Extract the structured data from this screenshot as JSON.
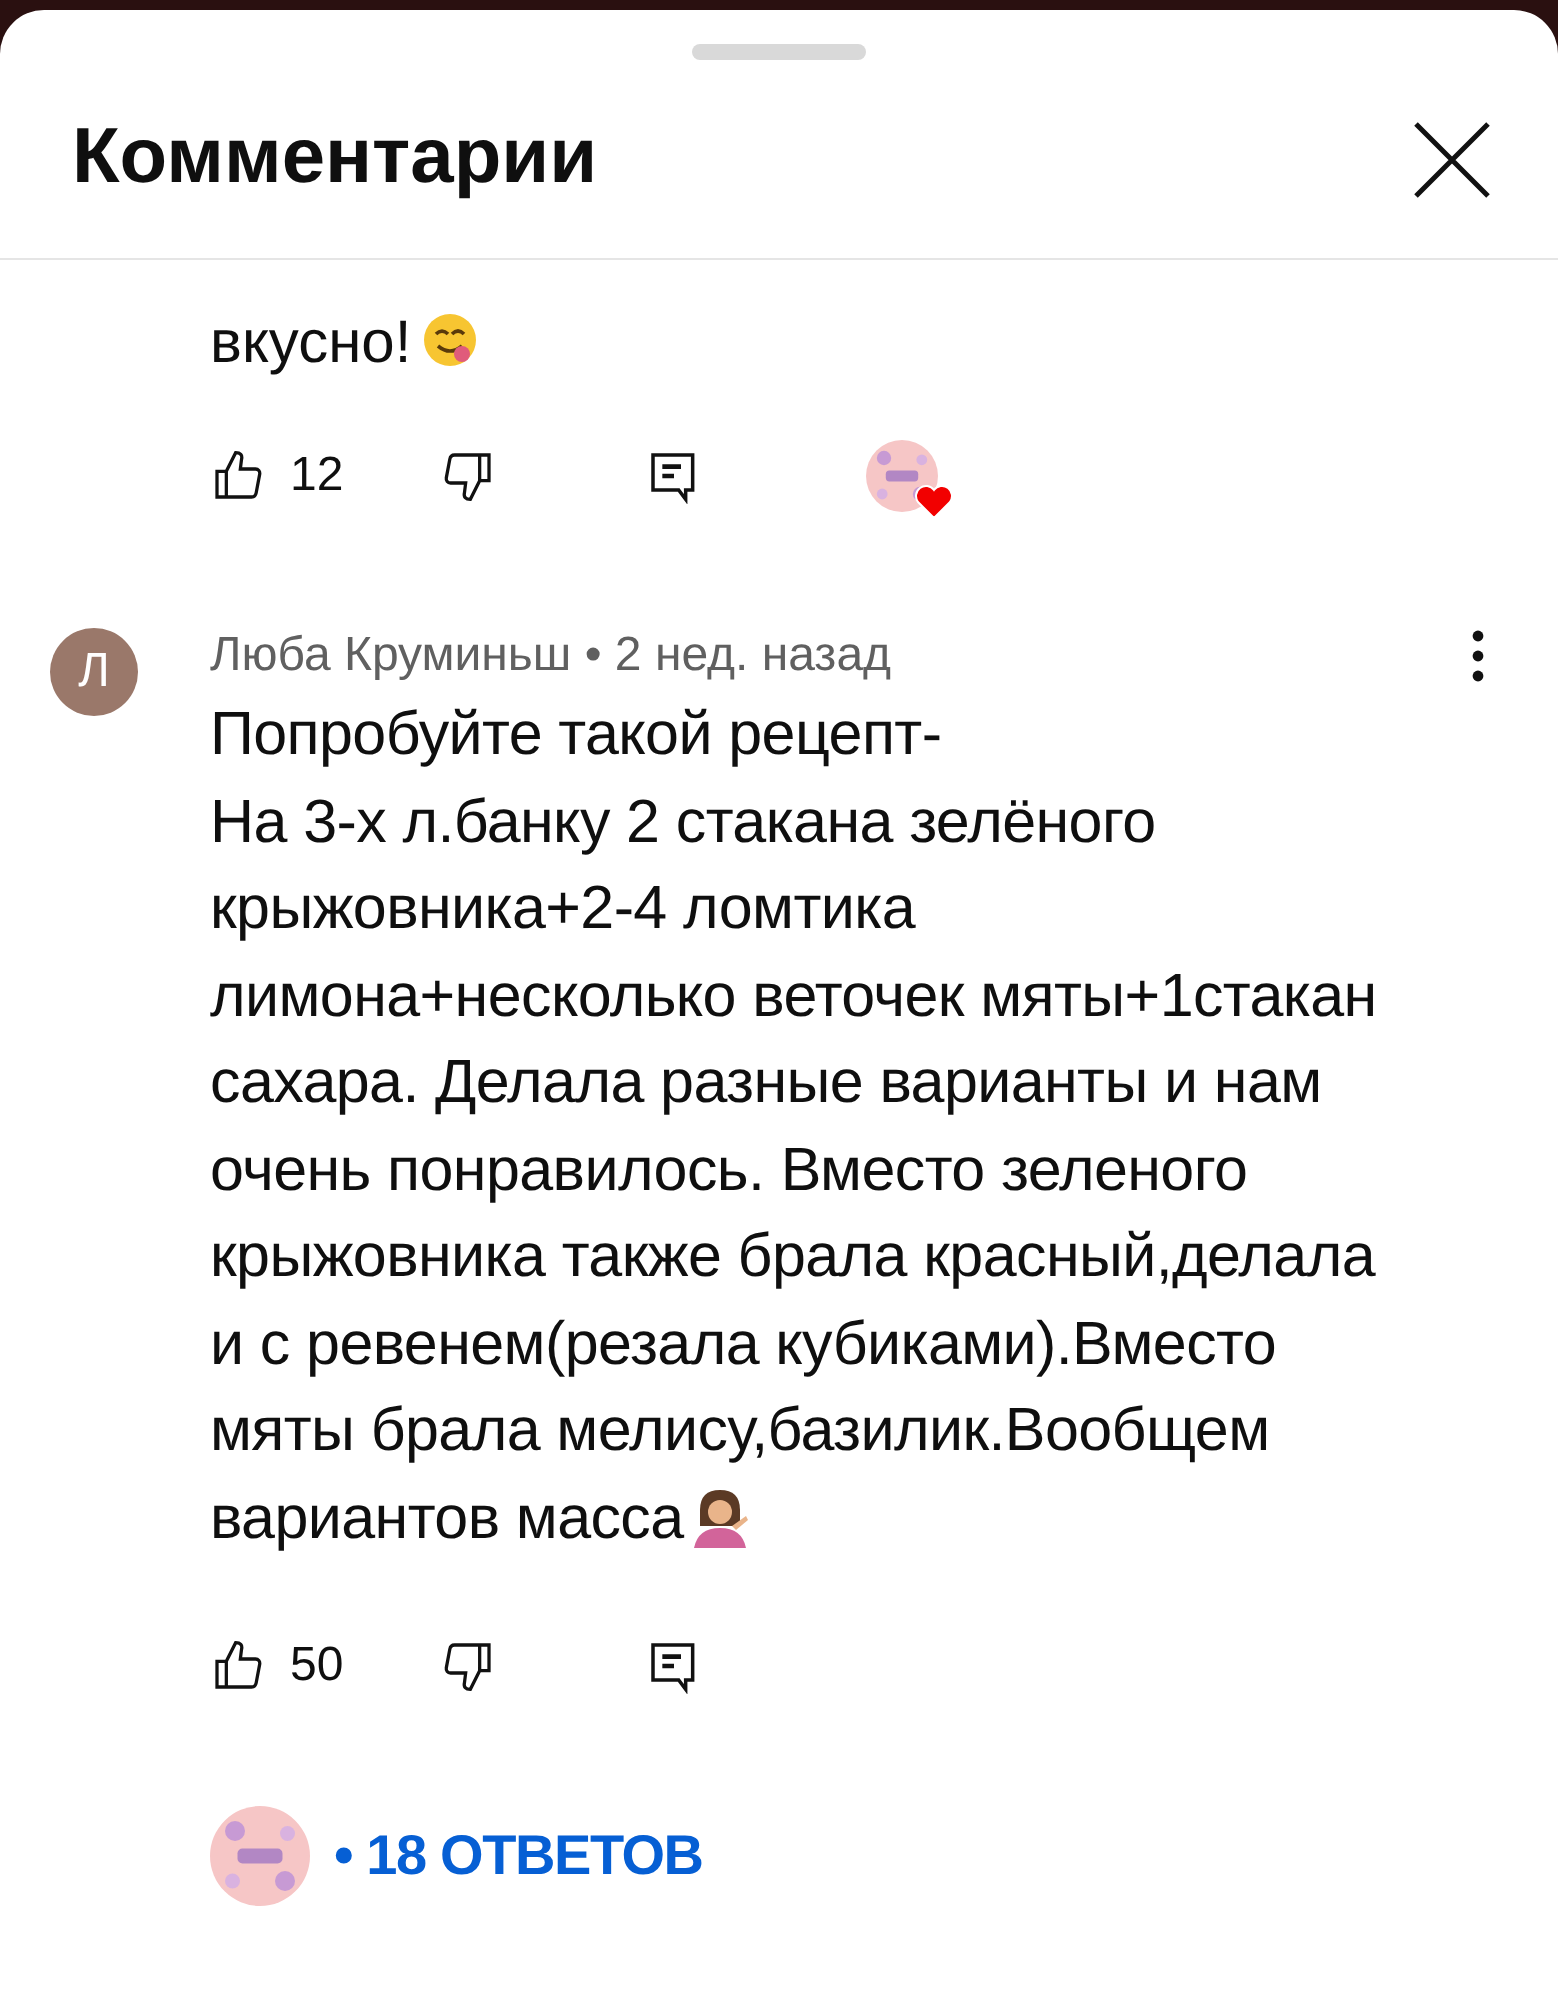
{
  "header": {
    "title": "Комментарии"
  },
  "comments": [
    {
      "lines": [
        "вкусно!"
      ],
      "kind": "face-emoji",
      "likes": "12",
      "creator_heart": true
    },
    {
      "avatar_letter": "Л",
      "author": "Люба Круминьш",
      "separator": "•",
      "time": "2 нед. назад",
      "lines": [
        "Попробуйте такой рецепт-",
        "На 3-х л.банку 2 стакана зелёного",
        "крыжовника+2-4 ломтика",
        "лимона+несколько веточек мяты+1стакан",
        "сахара. Делала разные варианты и нам",
        "очень понравилось. Вместо зеленого",
        "крыжовника также брала красный,делала",
        "и с ревенем(резала кубиками).Вместо",
        "мяты брала мелису,базилик.Вообщем",
        "вариантов масса"
      ],
      "kind": "person-emoji",
      "likes": "50",
      "creator_heart": false,
      "replies": "• 18 ОТВЕТОВ"
    }
  ]
}
